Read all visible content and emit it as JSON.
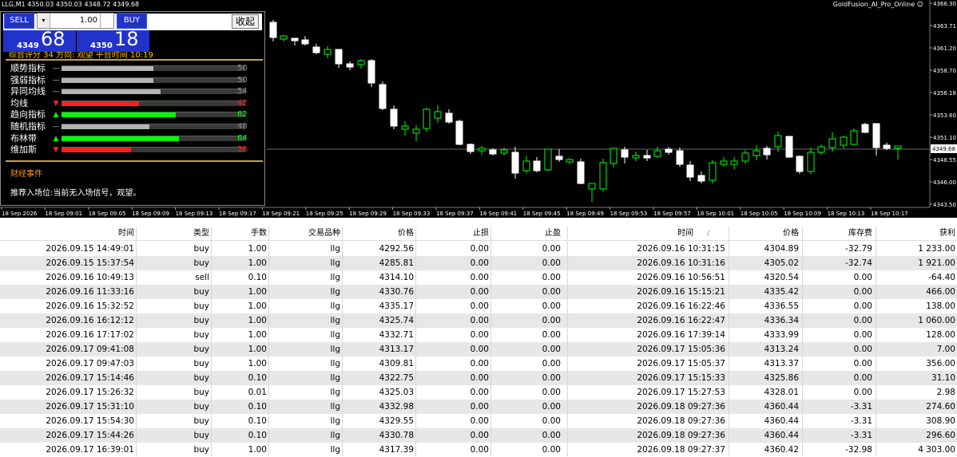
{
  "chart": {
    "title": "LLG,M1  4350.03 4350.03 4348.72 4349.68",
    "ea_name": "GoldFusion_AI_Pro_Online",
    "ea_icon": "smiley-icon",
    "bid_label": "4349.68",
    "y_ticks": [
      "4366.30",
      "4363.71",
      "4361.20",
      "4358.70",
      "4356.18",
      "4353.60",
      "4351.10",
      "4348.55",
      "4346.00",
      "4343.50"
    ],
    "x_ticks": [
      "18 Sep 2026",
      "18 Sep 09:01",
      "18 Sep 09:05",
      "18 Sep 09:09",
      "18 Sep 09:13",
      "18 Sep 09:17",
      "18 Sep 09:21",
      "18 Sep 09:25",
      "18 Sep 09:29",
      "18 Sep 09:33",
      "18 Sep 09:37",
      "18 Sep 09:41",
      "18 Sep 09:45",
      "18 Sep 09:49",
      "18 Sep 09:53",
      "18 Sep 09:57",
      "18 Sep 10:01",
      "18 Sep 10:05",
      "18 Sep 10:09",
      "18 Sep 10:13",
      "18 Sep 10:17"
    ],
    "colors": {
      "bull": "#00ff00",
      "bear": "#ffffff",
      "bg": "#000000",
      "grid": "#1e1e1e"
    }
  },
  "trade": {
    "sell_label": "SELL",
    "buy_label": "BUY",
    "lot_value": "1.00",
    "spin_icon": "spin-down-icon",
    "sell_small": "4349",
    "sell_big": "68",
    "buy_small": "4350",
    "buy_big": "18"
  },
  "panel": {
    "collapse_label": "收起",
    "cut_text": "综合评分 34   方向: 观望   平台时间 10:19",
    "indicators": [
      {
        "name": "顺势指标",
        "signal": "—",
        "value": 50,
        "color": "#b4b4b4"
      },
      {
        "name": "强弱指标",
        "signal": "—",
        "value": 50,
        "color": "#b4b4b4"
      },
      {
        "name": "异同均线",
        "signal": "—",
        "value": 54,
        "color": "#b4b4b4"
      },
      {
        "name": "均线",
        "signal": "▼",
        "value": 42,
        "color": "#ff2020"
      },
      {
        "name": "趋向指标",
        "signal": "▲",
        "value": 62,
        "color": "#00ff00"
      },
      {
        "name": "随机指标",
        "signal": "—",
        "value": 48,
        "color": "#b4b4b4"
      },
      {
        "name": "布林带",
        "signal": "▲",
        "value": 64,
        "color": "#00ff00"
      },
      {
        "name": "维加斯",
        "signal": "▼",
        "value": 38,
        "color": "#ff2020"
      }
    ],
    "news_title": "财经事件",
    "recommend_text": "推荐入场位:当前无入场信号，观望。"
  },
  "table": {
    "headers": {
      "time": "时间",
      "type": "类型",
      "lots": "手数",
      "symbol": "交易品种",
      "price": "价格",
      "sl": "止损",
      "tp": "止盈",
      "close_time": "时间",
      "sort_indicator": "/",
      "close_price": "价格",
      "swap": "库存费",
      "profit": "获利"
    },
    "rows": [
      {
        "time": "2026.09.15 14:49:01",
        "type": "buy",
        "lots": "1.00",
        "symbol": "llg",
        "price": "4292.56",
        "sl": "0.00",
        "tp": "0.00",
        "close_time": "2026.09.16 10:31:15",
        "close_price": "4304.89",
        "swap": "-32.79",
        "profit": "1 233.00"
      },
      {
        "time": "2026.09.15 15:37:54",
        "type": "buy",
        "lots": "1.00",
        "symbol": "llg",
        "price": "4285.81",
        "sl": "0.00",
        "tp": "0.00",
        "close_time": "2026.09.16 10:31:16",
        "close_price": "4305.02",
        "swap": "-32.74",
        "profit": "1 921.00"
      },
      {
        "time": "2026.09.16 10:49:13",
        "type": "sell",
        "lots": "0.10",
        "symbol": "llg",
        "price": "4314.10",
        "sl": "0.00",
        "tp": "0.00",
        "close_time": "2026.09.16 10:56:51",
        "close_price": "4320.54",
        "swap": "0.00",
        "profit": "-64.40"
      },
      {
        "time": "2026.09.16 11:33:16",
        "type": "buy",
        "lots": "1.00",
        "symbol": "llg",
        "price": "4330.76",
        "sl": "0.00",
        "tp": "0.00",
        "close_time": "2026.09.16 15:15:21",
        "close_price": "4335.42",
        "swap": "0.00",
        "profit": "466.00"
      },
      {
        "time": "2026.09.16 15:32:52",
        "type": "buy",
        "lots": "1.00",
        "symbol": "llg",
        "price": "4335.17",
        "sl": "0.00",
        "tp": "0.00",
        "close_time": "2026.09.16 16:22:46",
        "close_price": "4336.55",
        "swap": "0.00",
        "profit": "138.00"
      },
      {
        "time": "2026.09.16 16:12:12",
        "type": "buy",
        "lots": "1.00",
        "symbol": "llg",
        "price": "4325.74",
        "sl": "0.00",
        "tp": "0.00",
        "close_time": "2026.09.16 16:22:47",
        "close_price": "4336.34",
        "swap": "0.00",
        "profit": "1 060.00"
      },
      {
        "time": "2026.09.16 17:17:02",
        "type": "buy",
        "lots": "1.00",
        "symbol": "llg",
        "price": "4332.71",
        "sl": "0.00",
        "tp": "0.00",
        "close_time": "2026.09.16 17:39:14",
        "close_price": "4333.99",
        "swap": "0.00",
        "profit": "128.00"
      },
      {
        "time": "2026.09.17 09:41:08",
        "type": "buy",
        "lots": "1.00",
        "symbol": "llg",
        "price": "4313.17",
        "sl": "0.00",
        "tp": "0.00",
        "close_time": "2026.09.17 15:05:36",
        "close_price": "4313.24",
        "swap": "0.00",
        "profit": "7.00"
      },
      {
        "time": "2026.09.17 09:47:03",
        "type": "buy",
        "lots": "1.00",
        "symbol": "llg",
        "price": "4309.81",
        "sl": "0.00",
        "tp": "0.00",
        "close_time": "2026.09.17 15:05:37",
        "close_price": "4313.37",
        "swap": "0.00",
        "profit": "356.00"
      },
      {
        "time": "2026.09.17 15:14:46",
        "type": "buy",
        "lots": "0.10",
        "symbol": "llg",
        "price": "4322.75",
        "sl": "0.00",
        "tp": "0.00",
        "close_time": "2026.09.17 15:15:33",
        "close_price": "4325.86",
        "swap": "0.00",
        "profit": "31.10"
      },
      {
        "time": "2026.09.17 15:26:32",
        "type": "buy",
        "lots": "0.01",
        "symbol": "llg",
        "price": "4325.03",
        "sl": "0.00",
        "tp": "0.00",
        "close_time": "2026.09.17 15:27:53",
        "close_price": "4328.01",
        "swap": "0.00",
        "profit": "2.98"
      },
      {
        "time": "2026.09.17 15:31:10",
        "type": "buy",
        "lots": "0.10",
        "symbol": "llg",
        "price": "4332.98",
        "sl": "0.00",
        "tp": "0.00",
        "close_time": "2026.09.18 09:27:36",
        "close_price": "4360.44",
        "swap": "-3.31",
        "profit": "274.60"
      },
      {
        "time": "2026.09.17 15:54:30",
        "type": "buy",
        "lots": "0.10",
        "symbol": "llg",
        "price": "4329.55",
        "sl": "0.00",
        "tp": "0.00",
        "close_time": "2026.09.18 09:27:36",
        "close_price": "4360.44",
        "swap": "-3.31",
        "profit": "308.90"
      },
      {
        "time": "2026.09.17 15:44:26",
        "type": "buy",
        "lots": "0.10",
        "symbol": "llg",
        "price": "4330.78",
        "sl": "0.00",
        "tp": "0.00",
        "close_time": "2026.09.18 09:27:36",
        "close_price": "4360.44",
        "swap": "-3.31",
        "profit": "296.60"
      },
      {
        "time": "2026.09.17 16:39:01",
        "type": "buy",
        "lots": "1.00",
        "symbol": "llg",
        "price": "4317.39",
        "sl": "0.00",
        "tp": "0.00",
        "close_time": "2026.09.18 09:27:37",
        "close_price": "4360.42",
        "swap": "-32.98",
        "profit": "4 303.00"
      }
    ]
  }
}
